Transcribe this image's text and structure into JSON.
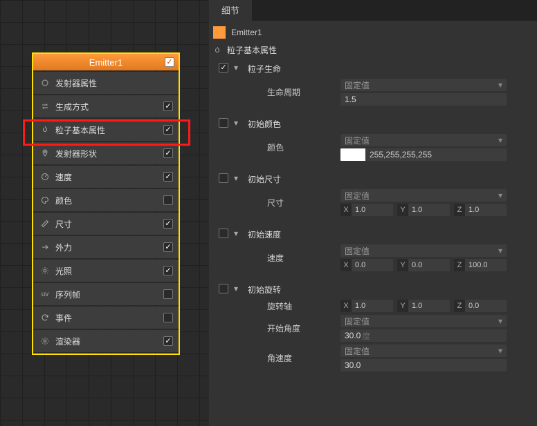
{
  "left": {
    "title": "Emitter1",
    "header_checked": true,
    "rows": [
      {
        "icon": "circle",
        "name": "emitter-props",
        "label": "发射器属性",
        "checked": null
      },
      {
        "icon": "swap",
        "name": "spawn-mode",
        "label": "生成方式",
        "checked": true
      },
      {
        "icon": "fire",
        "name": "particle-base",
        "label": "粒子基本属性",
        "checked": true
      },
      {
        "icon": "pin",
        "name": "emitter-shape",
        "label": "发射器形状",
        "checked": true
      },
      {
        "icon": "gauge",
        "name": "speed",
        "label": "速度",
        "checked": true
      },
      {
        "icon": "palette",
        "name": "color",
        "label": "颜色",
        "checked": false
      },
      {
        "icon": "ruler",
        "name": "size",
        "label": "尺寸",
        "checked": true
      },
      {
        "icon": "arrows",
        "name": "external-force",
        "label": "外力",
        "checked": true
      },
      {
        "icon": "light",
        "name": "lighting",
        "label": "光照",
        "checked": true
      },
      {
        "icon": "uv",
        "name": "sequence-frame",
        "label": "序列帧",
        "checked": false
      },
      {
        "icon": "refresh",
        "name": "event",
        "label": "事件",
        "checked": false
      },
      {
        "icon": "gear",
        "name": "renderer",
        "label": "渲染器",
        "checked": true
      }
    ]
  },
  "right": {
    "tab": "细节",
    "emitter_name": "Emitter1",
    "section_title": "粒子基本属性",
    "fixed_label": "固定值",
    "groups": {
      "life": {
        "checked": true,
        "title": "粒子生命",
        "period_label": "生命周期",
        "period_value": "1.5"
      },
      "initColor": {
        "checked": false,
        "title": "初始颜色",
        "color_label": "颜色",
        "color_value": "255,255,255,255"
      },
      "initSize": {
        "checked": false,
        "title": "初始尺寸",
        "size_label": "尺寸",
        "x": "1.0",
        "y": "1.0",
        "z": "1.0"
      },
      "initSpeed": {
        "checked": false,
        "title": "初始速度",
        "speed_label": "速度",
        "x": "0.0",
        "y": "0.0",
        "z": "100.0"
      },
      "initRot": {
        "checked": false,
        "title": "初始旋转",
        "axis_label": "旋转轴",
        "ax": "1.0",
        "ay": "1.0",
        "az": "0.0",
        "start_label": "开始角度",
        "start_value": "30.0",
        "start_unit": "度",
        "angvel_label": "角速度",
        "angvel_value": "30.0"
      }
    }
  }
}
